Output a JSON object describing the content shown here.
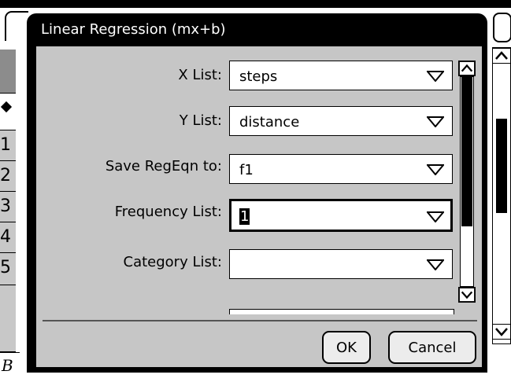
{
  "background": {
    "row_numbers": [
      "1",
      "2",
      "3",
      "4",
      "5"
    ],
    "bottom_cell_text": "B",
    "selected_row_marker": "diamond-icon"
  },
  "dialog": {
    "title": "Linear Regression (mx+b)",
    "fields": [
      {
        "label": "X List:",
        "value": "steps"
      },
      {
        "label": "Y List:",
        "value": "distance"
      },
      {
        "label": "Save RegEqn to:",
        "value": "f1"
      },
      {
        "label": "Frequency List:",
        "value": "1"
      },
      {
        "label": "Category List:",
        "value": ""
      }
    ],
    "ok_label": "OK",
    "cancel_label": "Cancel"
  },
  "colors": {
    "titlebar": "#000000",
    "dialog_body": "#c6c6c6",
    "field_bg": "#ffffff",
    "button_bg": "#ececec"
  }
}
